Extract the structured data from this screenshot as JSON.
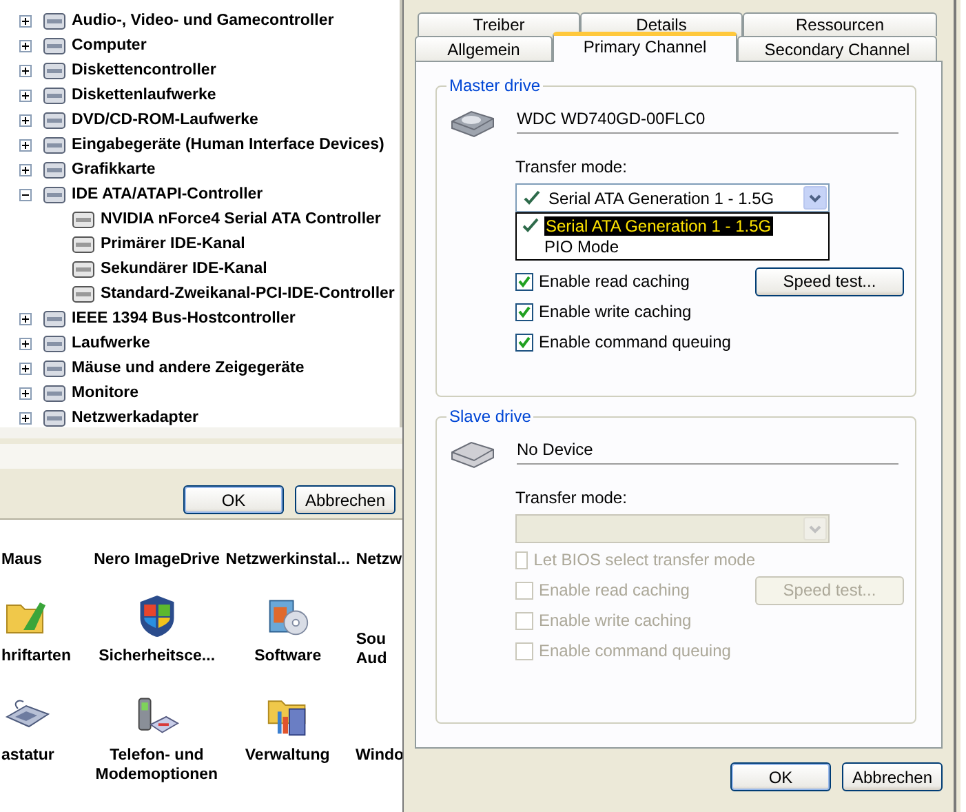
{
  "device_manager": {
    "tree": [
      {
        "label": "Audio-, Video- und Gamecontroller",
        "expanded": false
      },
      {
        "label": "Computer",
        "expanded": false
      },
      {
        "label": "Diskettencontroller",
        "expanded": false
      },
      {
        "label": "Diskettenlaufwerke",
        "expanded": false
      },
      {
        "label": "DVD/CD-ROM-Laufwerke",
        "expanded": false
      },
      {
        "label": "Eingabegeräte (Human Interface Devices)",
        "expanded": false
      },
      {
        "label": "Grafikkarte",
        "expanded": false
      },
      {
        "label": "IDE ATA/ATAPI-Controller",
        "expanded": true,
        "children": [
          {
            "label": "NVIDIA nForce4 Serial ATA Controller"
          },
          {
            "label": "Primärer IDE-Kanal"
          },
          {
            "label": "Sekundärer IDE-Kanal"
          },
          {
            "label": "Standard-Zweikanal-PCI-IDE-Controller"
          }
        ]
      },
      {
        "label": "IEEE 1394 Bus-Hostcontroller",
        "expanded": false
      },
      {
        "label": "Laufwerke",
        "expanded": false
      },
      {
        "label": "Mäuse und andere Zeigegeräte",
        "expanded": false
      },
      {
        "label": "Monitore",
        "expanded": false
      },
      {
        "label": "Netzwerkadapter",
        "expanded": false
      }
    ],
    "buttons": [
      "OK",
      "Abbrechen"
    ]
  },
  "control_panel": {
    "rows": [
      [
        {
          "label": "Maus"
        },
        {
          "label": "Nero ImageDrive"
        },
        {
          "label": "Netzwerkinstal..."
        },
        {
          "label": "Netzw"
        }
      ],
      [
        {
          "label": "hriftarten"
        },
        {
          "label": "Sicherheitsce..."
        },
        {
          "label": "Software"
        },
        {
          "label": "Sou Aud"
        }
      ],
      [
        {
          "label": "astatur"
        },
        {
          "label": "Telefon- und Modemoptionen"
        },
        {
          "label": "Verwaltung"
        },
        {
          "label": "Windo"
        }
      ]
    ]
  },
  "dialog": {
    "tab_rows": [
      [
        {
          "label": "Treiber",
          "selected": false
        },
        {
          "label": "Details",
          "selected": false
        },
        {
          "label": "Ressourcen",
          "selected": false
        }
      ],
      [
        {
          "label": "Allgemein",
          "selected": false
        },
        {
          "label": "Primary Channel",
          "selected": true
        },
        {
          "label": "Secondary Channel",
          "selected": false
        }
      ]
    ],
    "groups": [
      {
        "title": "Master drive",
        "disabled": false,
        "device": "WDC WD740GD-00FLC0",
        "transfer_label": "Transfer mode:",
        "transfer_value": "Serial ATA Generation 1 - 1.5G",
        "dropdown_open": true,
        "options": [
          {
            "label": "Serial ATA Generation 1 - 1.5G",
            "selected": true
          },
          {
            "label": "PIO Mode",
            "selected": false
          }
        ],
        "checkboxes": [
          {
            "label": "Enable read caching",
            "checked": true
          },
          {
            "label": "Enable write caching",
            "checked": true
          },
          {
            "label": "Enable command queuing",
            "checked": true
          }
        ],
        "speed_test": "Speed test..."
      },
      {
        "title": "Slave drive",
        "disabled": true,
        "device": "No Device",
        "transfer_label": "Transfer mode:",
        "dropdown_open": false,
        "checkboxes": [
          {
            "label": "Let BIOS select transfer mode",
            "checked": false
          },
          {
            "label": "Enable read caching",
            "checked": false
          },
          {
            "label": "Enable write caching",
            "checked": false
          },
          {
            "label": "Enable command queuing",
            "checked": false
          }
        ],
        "speed_test": "Speed test..."
      }
    ],
    "buttons": [
      "OK",
      "Abbrechen"
    ]
  }
}
